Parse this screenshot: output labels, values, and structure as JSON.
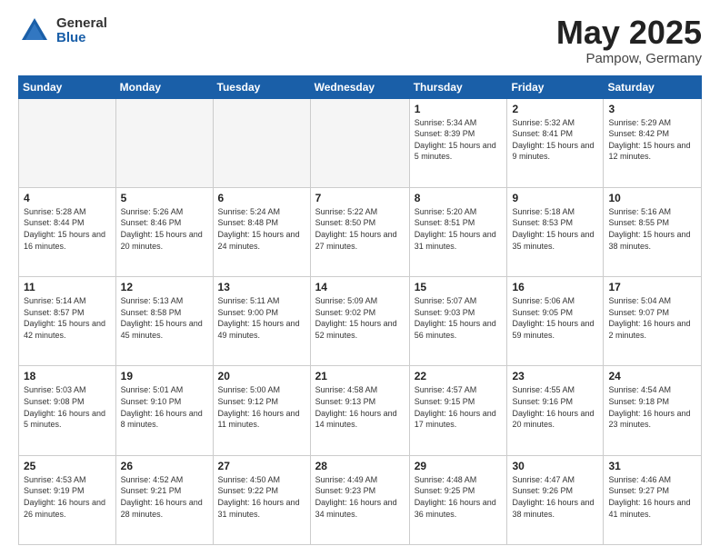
{
  "logo": {
    "general": "General",
    "blue": "Blue"
  },
  "title": {
    "month": "May 2025",
    "location": "Pampow, Germany"
  },
  "weekdays": [
    "Sunday",
    "Monday",
    "Tuesday",
    "Wednesday",
    "Thursday",
    "Friday",
    "Saturday"
  ],
  "weeks": [
    [
      {
        "day": "",
        "sunrise": "",
        "sunset": "",
        "daylight": ""
      },
      {
        "day": "",
        "sunrise": "",
        "sunset": "",
        "daylight": ""
      },
      {
        "day": "",
        "sunrise": "",
        "sunset": "",
        "daylight": ""
      },
      {
        "day": "",
        "sunrise": "",
        "sunset": "",
        "daylight": ""
      },
      {
        "day": "1",
        "sunrise": "Sunrise: 5:34 AM",
        "sunset": "Sunset: 8:39 PM",
        "daylight": "Daylight: 15 hours and 5 minutes."
      },
      {
        "day": "2",
        "sunrise": "Sunrise: 5:32 AM",
        "sunset": "Sunset: 8:41 PM",
        "daylight": "Daylight: 15 hours and 9 minutes."
      },
      {
        "day": "3",
        "sunrise": "Sunrise: 5:29 AM",
        "sunset": "Sunset: 8:42 PM",
        "daylight": "Daylight: 15 hours and 12 minutes."
      }
    ],
    [
      {
        "day": "4",
        "sunrise": "Sunrise: 5:28 AM",
        "sunset": "Sunset: 8:44 PM",
        "daylight": "Daylight: 15 hours and 16 minutes."
      },
      {
        "day": "5",
        "sunrise": "Sunrise: 5:26 AM",
        "sunset": "Sunset: 8:46 PM",
        "daylight": "Daylight: 15 hours and 20 minutes."
      },
      {
        "day": "6",
        "sunrise": "Sunrise: 5:24 AM",
        "sunset": "Sunset: 8:48 PM",
        "daylight": "Daylight: 15 hours and 24 minutes."
      },
      {
        "day": "7",
        "sunrise": "Sunrise: 5:22 AM",
        "sunset": "Sunset: 8:50 PM",
        "daylight": "Daylight: 15 hours and 27 minutes."
      },
      {
        "day": "8",
        "sunrise": "Sunrise: 5:20 AM",
        "sunset": "Sunset: 8:51 PM",
        "daylight": "Daylight: 15 hours and 31 minutes."
      },
      {
        "day": "9",
        "sunrise": "Sunrise: 5:18 AM",
        "sunset": "Sunset: 8:53 PM",
        "daylight": "Daylight: 15 hours and 35 minutes."
      },
      {
        "day": "10",
        "sunrise": "Sunrise: 5:16 AM",
        "sunset": "Sunset: 8:55 PM",
        "daylight": "Daylight: 15 hours and 38 minutes."
      }
    ],
    [
      {
        "day": "11",
        "sunrise": "Sunrise: 5:14 AM",
        "sunset": "Sunset: 8:57 PM",
        "daylight": "Daylight: 15 hours and 42 minutes."
      },
      {
        "day": "12",
        "sunrise": "Sunrise: 5:13 AM",
        "sunset": "Sunset: 8:58 PM",
        "daylight": "Daylight: 15 hours and 45 minutes."
      },
      {
        "day": "13",
        "sunrise": "Sunrise: 5:11 AM",
        "sunset": "Sunset: 9:00 PM",
        "daylight": "Daylight: 15 hours and 49 minutes."
      },
      {
        "day": "14",
        "sunrise": "Sunrise: 5:09 AM",
        "sunset": "Sunset: 9:02 PM",
        "daylight": "Daylight: 15 hours and 52 minutes."
      },
      {
        "day": "15",
        "sunrise": "Sunrise: 5:07 AM",
        "sunset": "Sunset: 9:03 PM",
        "daylight": "Daylight: 15 hours and 56 minutes."
      },
      {
        "day": "16",
        "sunrise": "Sunrise: 5:06 AM",
        "sunset": "Sunset: 9:05 PM",
        "daylight": "Daylight: 15 hours and 59 minutes."
      },
      {
        "day": "17",
        "sunrise": "Sunrise: 5:04 AM",
        "sunset": "Sunset: 9:07 PM",
        "daylight": "Daylight: 16 hours and 2 minutes."
      }
    ],
    [
      {
        "day": "18",
        "sunrise": "Sunrise: 5:03 AM",
        "sunset": "Sunset: 9:08 PM",
        "daylight": "Daylight: 16 hours and 5 minutes."
      },
      {
        "day": "19",
        "sunrise": "Sunrise: 5:01 AM",
        "sunset": "Sunset: 9:10 PM",
        "daylight": "Daylight: 16 hours and 8 minutes."
      },
      {
        "day": "20",
        "sunrise": "Sunrise: 5:00 AM",
        "sunset": "Sunset: 9:12 PM",
        "daylight": "Daylight: 16 hours and 11 minutes."
      },
      {
        "day": "21",
        "sunrise": "Sunrise: 4:58 AM",
        "sunset": "Sunset: 9:13 PM",
        "daylight": "Daylight: 16 hours and 14 minutes."
      },
      {
        "day": "22",
        "sunrise": "Sunrise: 4:57 AM",
        "sunset": "Sunset: 9:15 PM",
        "daylight": "Daylight: 16 hours and 17 minutes."
      },
      {
        "day": "23",
        "sunrise": "Sunrise: 4:55 AM",
        "sunset": "Sunset: 9:16 PM",
        "daylight": "Daylight: 16 hours and 20 minutes."
      },
      {
        "day": "24",
        "sunrise": "Sunrise: 4:54 AM",
        "sunset": "Sunset: 9:18 PM",
        "daylight": "Daylight: 16 hours and 23 minutes."
      }
    ],
    [
      {
        "day": "25",
        "sunrise": "Sunrise: 4:53 AM",
        "sunset": "Sunset: 9:19 PM",
        "daylight": "Daylight: 16 hours and 26 minutes."
      },
      {
        "day": "26",
        "sunrise": "Sunrise: 4:52 AM",
        "sunset": "Sunset: 9:21 PM",
        "daylight": "Daylight: 16 hours and 28 minutes."
      },
      {
        "day": "27",
        "sunrise": "Sunrise: 4:50 AM",
        "sunset": "Sunset: 9:22 PM",
        "daylight": "Daylight: 16 hours and 31 minutes."
      },
      {
        "day": "28",
        "sunrise": "Sunrise: 4:49 AM",
        "sunset": "Sunset: 9:23 PM",
        "daylight": "Daylight: 16 hours and 34 minutes."
      },
      {
        "day": "29",
        "sunrise": "Sunrise: 4:48 AM",
        "sunset": "Sunset: 9:25 PM",
        "daylight": "Daylight: 16 hours and 36 minutes."
      },
      {
        "day": "30",
        "sunrise": "Sunrise: 4:47 AM",
        "sunset": "Sunset: 9:26 PM",
        "daylight": "Daylight: 16 hours and 38 minutes."
      },
      {
        "day": "31",
        "sunrise": "Sunrise: 4:46 AM",
        "sunset": "Sunset: 9:27 PM",
        "daylight": "Daylight: 16 hours and 41 minutes."
      }
    ]
  ]
}
